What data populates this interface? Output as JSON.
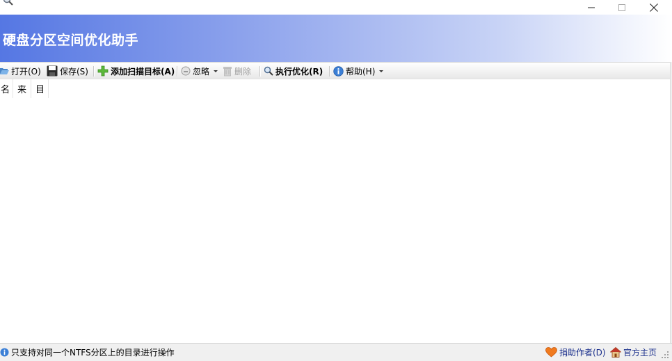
{
  "window": {
    "title": "硬盘分区空间优化助手"
  },
  "toolbar": {
    "open_label": "打开(O)",
    "save_label": "保存(S)",
    "add_target_label": "添加扫描目标(A)",
    "ignore_label": "忽略",
    "delete_label": "删除",
    "optimize_label": "执行优化(R)",
    "help_label": "帮助(H)"
  },
  "list": {
    "columns": [
      "名",
      "来",
      "目"
    ]
  },
  "status": {
    "message": "只支持对同一个NTFS分区上的目录进行操作",
    "donate_label": "捐助作者(D)",
    "homepage_label": "官方主页"
  },
  "colors": {
    "banner_start": "#5577e3",
    "banner_end": "#ffffff",
    "link": "#1a2f8c"
  },
  "icons": [
    "folder-open-icon",
    "save-icon",
    "add-icon",
    "ignore-icon",
    "delete-icon",
    "magnifier-icon",
    "info-icon",
    "heart-icon",
    "home-icon"
  ]
}
